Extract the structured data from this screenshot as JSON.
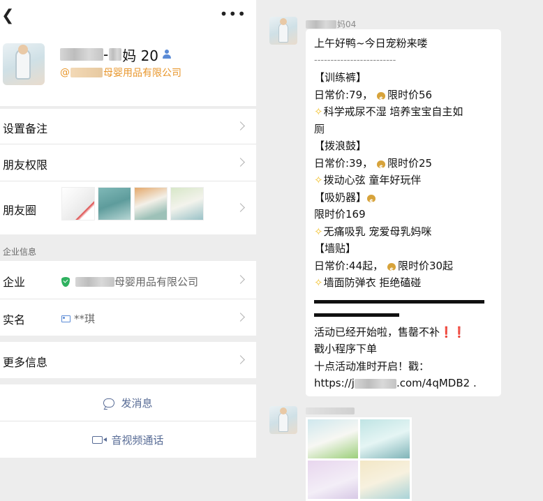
{
  "profile": {
    "name_suffix": "-",
    "name_tail": "妈 20",
    "company_prefix": "@",
    "company_suffix": "母婴用品有限公司"
  },
  "left_rows": {
    "remark": "设置备注",
    "permission": "朋友权限",
    "moments": "朋友圈"
  },
  "enterprise": {
    "section_title": "企业信息",
    "company_label": "企业",
    "company_value": "母婴用品有限公司",
    "realname_label": "实名",
    "realname_value": "**琪",
    "more_label": "更多信息"
  },
  "actions": {
    "send_message": "发消息",
    "av_call": "音视频通话"
  },
  "chat": {
    "sender_suffix": "妈04",
    "lines": {
      "greeting": "上午好鸭~今日宠粉来喽",
      "dash": "-------------------------",
      "p1_title": "【训练裤】",
      "p1_daily": "日常价:79，",
      "p1_limit": "限时价56",
      "p1_desc_1": "科学戒尿不湿 培养宝宝自主如",
      "p1_desc_2": "厕",
      "p2_title": "【拨浪鼓】",
      "p2_daily": "日常价:39，",
      "p2_limit": "限时价25",
      "p2_desc": "拨动心弦 童年好玩伴",
      "p3_title": "【吸奶器】",
      "p3_limit": " 限时价169",
      "p3_desc": "无痛吸乳 宠爱母乳妈咪",
      "p4_title": "【墙贴】",
      "p4_daily": "日常价:44起，",
      "p4_limit": "限时价30起",
      "p4_desc": "墙面防弹衣 拒绝磕碰",
      "event": "活动已经开始啦，售罄不补",
      "mini": "戳小程序下单",
      "start": "十点活动准时开启！戳：",
      "link_prefix": "https://j",
      "link_suffix": ".com/4qMDB2 ."
    }
  },
  "icons": {
    "back": "chevron-left-icon",
    "more": "more-icon",
    "verified": "shield-check-icon",
    "id": "id-card-icon",
    "message": "message-icon",
    "video": "video-icon",
    "money": "money-bag-icon",
    "star": "star-icon"
  },
  "colors": {
    "link": "#576b95",
    "company": "#e8962b",
    "verified": "#2fb15f",
    "alert": "#d62f2f"
  }
}
